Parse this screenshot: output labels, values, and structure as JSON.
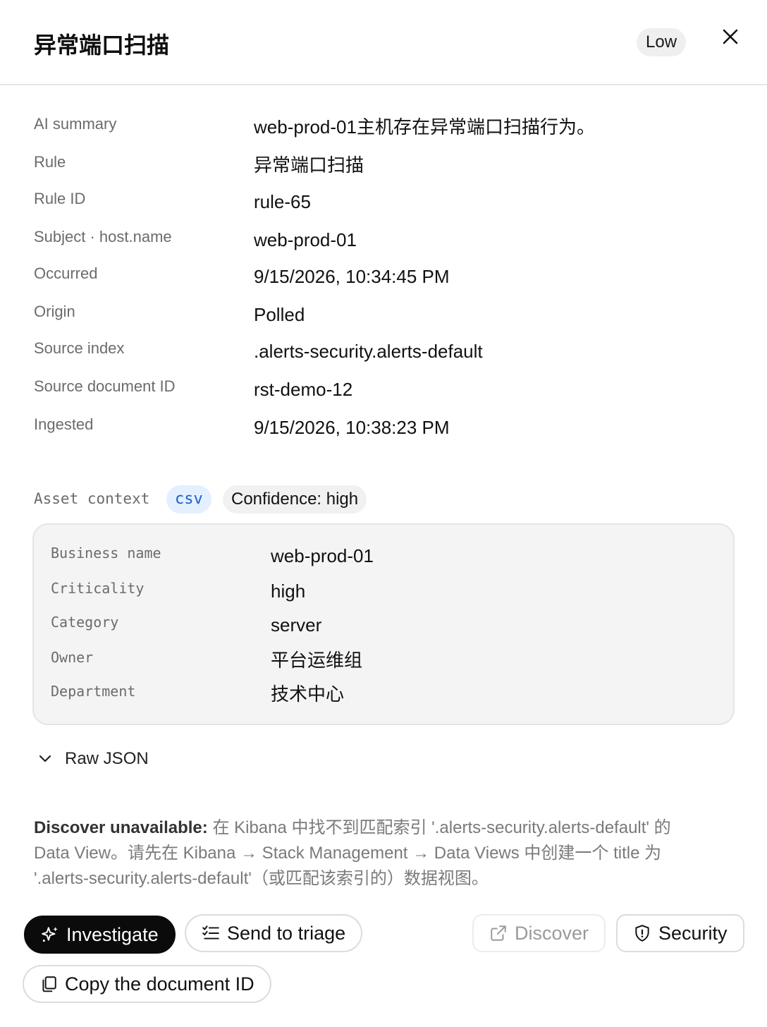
{
  "header": {
    "title": "异常端口扫描",
    "severity": "Low"
  },
  "fields": [
    {
      "label": "AI summary",
      "value": "web-prod-01主机存在异常端口扫描行为。"
    },
    {
      "label": "Rule",
      "value": "异常端口扫描"
    },
    {
      "label": "Rule ID",
      "value": "rule-65"
    },
    {
      "label": "Subject · host.name",
      "value": "web-prod-01"
    },
    {
      "label": "Occurred",
      "value": "9/15/2026, 10:34:45 PM"
    },
    {
      "label": "Origin",
      "value": "Polled"
    },
    {
      "label": "Source index",
      "value": ".alerts-security.alerts-default"
    },
    {
      "label": "Source document ID",
      "value": "rst-demo-12"
    },
    {
      "label": "Ingested",
      "value": "9/15/2026, 10:38:23 PM"
    }
  ],
  "asset": {
    "label": "Asset context",
    "source_pill": "csv",
    "confidence_pill": "Confidence: high",
    "rows": [
      {
        "key": "Business name",
        "value": "web-prod-01"
      },
      {
        "key": "Criticality",
        "value": "high"
      },
      {
        "key": "Category",
        "value": "server"
      },
      {
        "key": "Owner",
        "value": "平台运维组"
      },
      {
        "key": "Department",
        "value": "技术中心"
      }
    ]
  },
  "raw_json": {
    "label": "Raw JSON"
  },
  "notice": {
    "prefix": "Discover unavailable:",
    "text": "在 Kibana 中找不到匹配索引 '.alerts-security.alerts-default' 的 Data View。请先在 Kibana → Stack Management → Data Views 中创建一个 title 为 '.alerts-security.alerts-default'（或匹配该索引的）数据视图。"
  },
  "actions": {
    "investigate": "Investigate",
    "send_to_triage": "Send to triage",
    "discover": "Discover",
    "security": "Security",
    "copy_doc_id": "Copy the document ID"
  },
  "colors": {
    "primary_button": "#0b0b0b",
    "csv_pill_bg": "#e4efff",
    "csv_pill_text": "#1c62c9"
  }
}
